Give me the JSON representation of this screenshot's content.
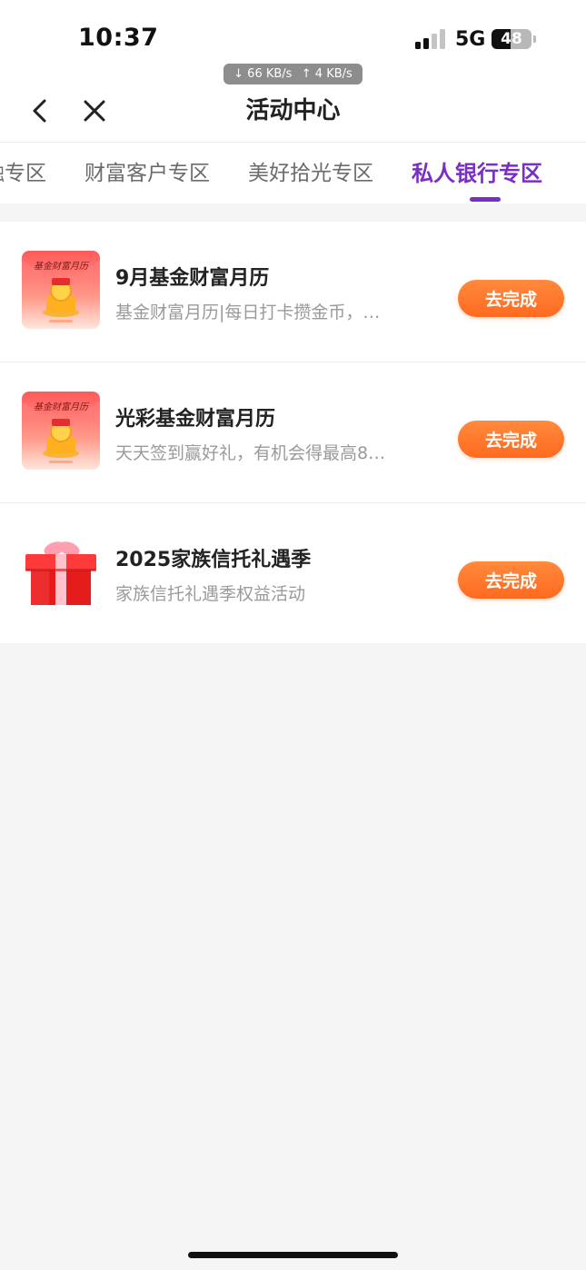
{
  "status_bar": {
    "time": "10:37",
    "network": "5G",
    "battery": "48",
    "download_speed": "↓ 66 KB/s",
    "upload_speed": "↑ 4 KB/s"
  },
  "nav": {
    "title": "活动中心",
    "back_icon": "chevron-left-icon",
    "close_icon": "close-icon"
  },
  "tabs": [
    {
      "label": "融专区",
      "active": false
    },
    {
      "label": "财富客户专区",
      "active": false
    },
    {
      "label": "美好拾光专区",
      "active": false
    },
    {
      "label": "私人银行专区",
      "active": true
    }
  ],
  "activities": [
    {
      "thumb_text": "基金财富月历",
      "title": "9月基金财富月历",
      "subtitle": "基金财富月历|每日打卡攒金币，…",
      "button": "去完成",
      "icon": "gift-coin-icon"
    },
    {
      "thumb_text": "基金财富月历",
      "title": "光彩基金财富月历",
      "subtitle": "天天签到赢好礼，有机会得最高8…",
      "button": "去完成",
      "icon": "gift-coin-icon"
    },
    {
      "title": "2025家族信托礼遇季",
      "subtitle": "家族信托礼遇季权益活动",
      "button": "去完成",
      "icon": "gift-box-icon"
    }
  ],
  "colors": {
    "accent": "#7a2fc4",
    "cta": "#ff7a2b",
    "page_bg": "#f5f5f5"
  }
}
